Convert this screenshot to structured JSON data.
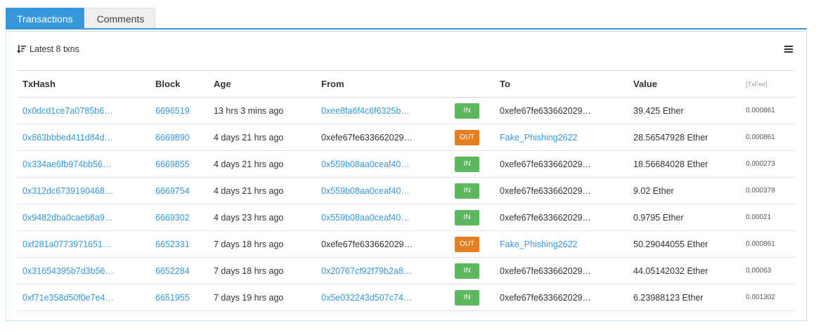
{
  "tabs": [
    {
      "label": "Transactions",
      "active": true
    },
    {
      "label": "Comments",
      "active": false
    }
  ],
  "header": {
    "latest_label": "Latest 8 txns",
    "sort_icon": "sort-desc-icon",
    "menu_icon": "hamburger-menu-icon"
  },
  "columns": {
    "txhash": "TxHash",
    "block": "Block",
    "age": "Age",
    "from": "From",
    "to": "To",
    "value": "Value",
    "txfee": "[TxFee]"
  },
  "colors": {
    "accent": "#3498db",
    "in_badge": "#5cb85c",
    "out_badge": "#e67e22",
    "panel_border": "#c7e3f0"
  },
  "rows": [
    {
      "txhash": "0x0dcd1ce7a0785b6…",
      "block": "6696519",
      "age": "13 hrs 3 mins ago",
      "from": "0xee8fa6f4c6f6325b…",
      "from_link": true,
      "direction": "IN",
      "to": "0xefe67fe633662029…",
      "to_link": false,
      "value": "39.425 Ether",
      "fee": "0.000861"
    },
    {
      "txhash": "0x863bbbed411d84d…",
      "block": "6669890",
      "age": "4 days 21 hrs ago",
      "from": "0xefe67fe633662029…",
      "from_link": false,
      "direction": "OUT",
      "to": "Fake_Phishing2622",
      "to_link": true,
      "value": "28.56547928 Ether",
      "fee": "0.000861"
    },
    {
      "txhash": "0x334ae6fb974bb56…",
      "block": "6669855",
      "age": "4 days 21 hrs ago",
      "from": "0x559b08aa0ceaf40…",
      "from_link": true,
      "direction": "IN",
      "to": "0xefe67fe633662029…",
      "to_link": false,
      "value": "18.56684028 Ether",
      "fee": "0.000273"
    },
    {
      "txhash": "0x312dc6739190468…",
      "block": "6669754",
      "age": "4 days 21 hrs ago",
      "from": "0x559b08aa0ceaf40…",
      "from_link": true,
      "direction": "IN",
      "to": "0xefe67fe633662029…",
      "to_link": false,
      "value": "9.02 Ether",
      "fee": "0.000378"
    },
    {
      "txhash": "0x9482dba0caeb8a9…",
      "block": "6669302",
      "age": "4 days 23 hrs ago",
      "from": "0x559b08aa0ceaf40…",
      "from_link": true,
      "direction": "IN",
      "to": "0xefe67fe633662029…",
      "to_link": false,
      "value": "0.9795 Ether",
      "fee": "0.00021"
    },
    {
      "txhash": "0xf281a0773971651…",
      "block": "6652331",
      "age": "7 days 18 hrs ago",
      "from": "0xefe67fe633662029…",
      "from_link": false,
      "direction": "OUT",
      "to": "Fake_Phishing2622",
      "to_link": true,
      "value": "50.29044055 Ether",
      "fee": "0.000861"
    },
    {
      "txhash": "0x31654395b7d3b56…",
      "block": "6652284",
      "age": "7 days 18 hrs ago",
      "from": "0x20767cf92f79b2a8…",
      "from_link": true,
      "direction": "IN",
      "to": "0xefe67fe633662029…",
      "to_link": false,
      "value": "44.05142032 Ether",
      "fee": "0.00063"
    },
    {
      "txhash": "0xf71e358d50f0e7e4…",
      "block": "6651955",
      "age": "7 days 19 hrs ago",
      "from": "0x5e032243d507c74…",
      "from_link": true,
      "direction": "IN",
      "to": "0xefe67fe633662029…",
      "to_link": false,
      "value": "6.23988123 Ether",
      "fee": "0.001302"
    }
  ]
}
